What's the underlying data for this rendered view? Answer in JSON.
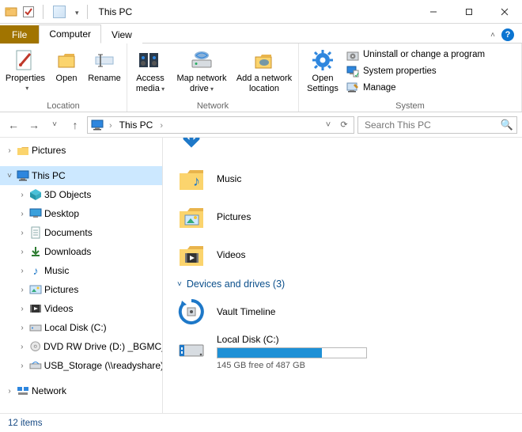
{
  "window": {
    "title": "This PC"
  },
  "tabs": {
    "file": "File",
    "computer": "Computer",
    "view": "View"
  },
  "ribbon": {
    "location": {
      "label": "Location",
      "properties": "Properties",
      "open": "Open",
      "rename": "Rename"
    },
    "network": {
      "label": "Network",
      "access_media": "Access media",
      "map_drive": "Map network drive",
      "add_location": "Add a network location"
    },
    "open_settings": "Open Settings",
    "system": {
      "label": "System",
      "uninstall": "Uninstall or change a program",
      "properties": "System properties",
      "manage": "Manage"
    }
  },
  "nav": {
    "breadcrumb": "This PC",
    "search_placeholder": "Search This PC"
  },
  "tree": {
    "pictures": "Pictures",
    "this_pc": "This PC",
    "items": [
      "3D Objects",
      "Desktop",
      "Documents",
      "Downloads",
      "Music",
      "Pictures",
      "Videos",
      "Local Disk (C:)",
      "DVD RW Drive (D:) _BGMC_V",
      "USB_Storage (\\\\readyshare)"
    ],
    "network": "Network"
  },
  "content": {
    "folders": [
      "Music",
      "Pictures",
      "Videos"
    ],
    "group_devices": "Devices and drives (3)",
    "vault": "Vault Timeline",
    "local_disk": {
      "label": "Local Disk (C:)",
      "free_text": "145 GB free of 487 GB",
      "used_fraction": 0.7
    }
  },
  "status": {
    "count": "12 items"
  }
}
